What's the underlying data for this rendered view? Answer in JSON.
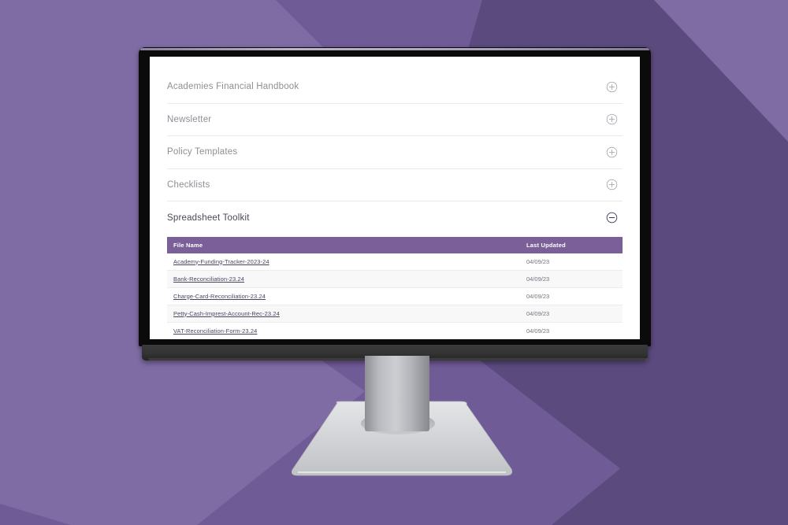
{
  "accordion": {
    "items": [
      {
        "label": "Academies Financial Handbook",
        "icon": "plus-circle-icon",
        "expanded": false
      },
      {
        "label": "Newsletter",
        "icon": "plus-circle-icon",
        "expanded": false
      },
      {
        "label": "Policy Templates",
        "icon": "plus-circle-icon",
        "expanded": false
      },
      {
        "label": "Checklists",
        "icon": "plus-circle-icon",
        "expanded": false
      },
      {
        "label": "Spreadsheet Toolkit",
        "icon": "minus-circle-icon",
        "expanded": true
      }
    ]
  },
  "table": {
    "columns": [
      "File Name",
      "Last Updated"
    ],
    "rows": [
      {
        "file_name": "Academy-Funding-Tracker-2023-24",
        "last_updated": "04/09/23"
      },
      {
        "file_name": "Bank-Reconciliation-23.24",
        "last_updated": "04/09/23"
      },
      {
        "file_name": "Charge-Card-Reconciliation-23.24",
        "last_updated": "04/09/23"
      },
      {
        "file_name": "Petty-Cash-Imprest-Account-Rec-23.24",
        "last_updated": "04/09/23"
      },
      {
        "file_name": "VAT-Reconciliation-Form-23.24",
        "last_updated": "04/09/23"
      }
    ]
  },
  "colors": {
    "background_purple": "#6f5b96",
    "background_purple_dark": "#5b4a7d",
    "background_purple_light": "#7f6ca4",
    "table_header_purple": "#7b5f99",
    "link_text": "#4b4360",
    "label_text": "#8e8e96",
    "bezel": "#0b0b0b"
  }
}
